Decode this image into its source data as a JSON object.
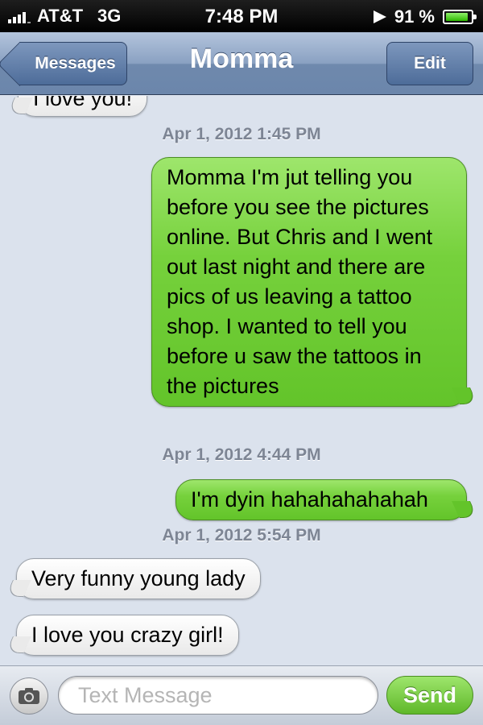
{
  "status_bar": {
    "carrier": "AT&T",
    "network": "3G",
    "time": "7:48 PM",
    "battery_percent_text": "91 %",
    "battery_level": 0.91,
    "battery_color": "#4cd400",
    "signal_bars": 4
  },
  "nav": {
    "back_label": "Messages",
    "title": "Momma",
    "edit_label": "Edit"
  },
  "conversation": {
    "messages": [
      {
        "type": "incoming",
        "text": "I love you!"
      },
      {
        "type": "timestamp",
        "text": "Apr 1, 2012 1:45 PM"
      },
      {
        "type": "outgoing",
        "text": "Momma I'm jut telling you before you see the pictures online. But Chris and I went out last night and there are pics of us leaving a tattoo shop. I wanted to tell you before u saw the tattoos in the pictures"
      },
      {
        "type": "timestamp",
        "text": "Apr 1, 2012 4:44 PM"
      },
      {
        "type": "outgoing",
        "text": "I'm dyin hahahahahahah"
      },
      {
        "type": "timestamp",
        "text": "Apr 1, 2012 5:54 PM"
      },
      {
        "type": "incoming",
        "text": "Very funny young lady"
      },
      {
        "type": "incoming",
        "text": "I love you crazy girl!"
      }
    ]
  },
  "input_bar": {
    "placeholder": "Text Message",
    "value": "",
    "send_label": "Send",
    "camera_icon": "camera-icon"
  },
  "colors": {
    "outgoing_bubble": "#76d13c",
    "incoming_bubble": "#ffffff",
    "background": "#dbe2ed",
    "nav_bar": "#8aa1c2"
  }
}
